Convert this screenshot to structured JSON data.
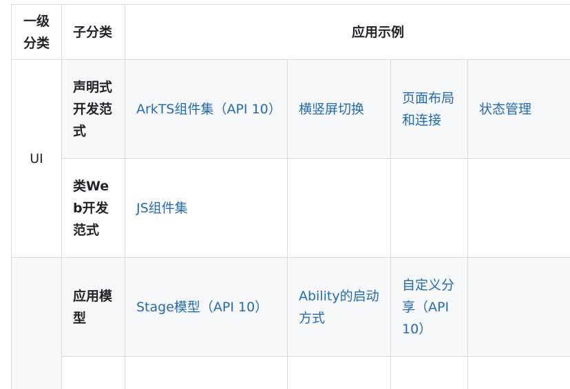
{
  "table": {
    "headers": {
      "level1": "一级分类",
      "level2": "子分类",
      "examples": "应用示例"
    },
    "groups": [
      {
        "level1": "UI",
        "rows": [
          {
            "level2": "声明式开发范式",
            "cells": [
              "ArkTS组件集（API 10）",
              "横竖屏切换",
              "页面布局和连接",
              "状态管理"
            ]
          },
          {
            "level2": "类Web开发范式",
            "cells": [
              "JS组件集",
              "",
              "",
              ""
            ]
          }
        ]
      },
      {
        "level1": "",
        "rows": [
          {
            "level2": "应用模型",
            "cells": [
              "Stage模型（API 10）",
              "Ability的启动方式",
              "自定义分享（API 10）",
              ""
            ]
          }
        ]
      }
    ]
  }
}
